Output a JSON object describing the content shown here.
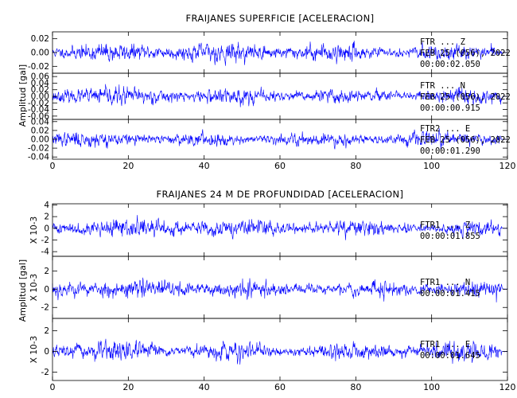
{
  "chart_data": [
    {
      "type": "line",
      "title": "FRAIJANES SUPERFICIE [ACELERACION]",
      "ylabel": "Amplitud [gal]",
      "xlim": [
        0,
        120
      ],
      "xticks": [
        0,
        20,
        40,
        60,
        80,
        100,
        120
      ],
      "color": "#0000ff",
      "panels": [
        {
          "ylim": [
            -0.03,
            0.03
          ],
          "yticks": [
            "0.02",
            "0.00",
            "-0.02"
          ],
          "ytick_values": [
            0.02,
            0.0,
            -0.02
          ],
          "amplitude": 0.009,
          "seed": 11,
          "annotation": [
            "FTR ... Z",
            "FEB 25 (056), 2022",
            "00:00:02.050"
          ]
        },
        {
          "ylim": [
            -0.07,
            0.07
          ],
          "yticks": [
            "0.06",
            "0.04",
            "0.02",
            "0.00",
            "-0.02",
            "-0.04",
            "-0.06"
          ],
          "ytick_values": [
            0.06,
            0.04,
            0.02,
            0.0,
            -0.02,
            -0.04,
            -0.06
          ],
          "amplitude": 0.018,
          "seed": 23,
          "annotation": [
            "FTR ... N",
            "FEB 25 (056), 2022",
            "00:00:00.915"
          ]
        },
        {
          "ylim": [
            -0.045,
            0.045
          ],
          "yticks": [
            "0.04",
            "0.02",
            "0.00",
            "-0.02",
            "-0.04"
          ],
          "ytick_values": [
            0.04,
            0.02,
            0.0,
            -0.02,
            -0.04
          ],
          "amplitude": 0.012,
          "seed": 37,
          "annotation": [
            "FTR2 ... E",
            "FEB 25 (056), 2022",
            "00:00:01.290"
          ]
        }
      ]
    },
    {
      "type": "line",
      "title": "FRAIJANES 24 M DE PROFUNDIDAD [ACELERACION]",
      "ylabel": "Amplitud [gal]",
      "xlim": [
        0,
        120
      ],
      "xticks": [
        0,
        20,
        40,
        60,
        80,
        100,
        120
      ],
      "color": "#0000ff",
      "panels": [
        {
          "ylim": [
            -4.8,
            4.2
          ],
          "yticks": [
            "4",
            "2",
            "0",
            "-2",
            "-4"
          ],
          "ytick_values": [
            4,
            2,
            0,
            -2,
            -4
          ],
          "amplitude": 1.1,
          "seed": 41,
          "scale_label": "X 10-3",
          "annotation": [
            "FTR1 ... Z",
            "00:00:01.855"
          ]
        },
        {
          "ylim": [
            -3.2,
            3.6
          ],
          "yticks": [
            "2",
            "0",
            "-2"
          ],
          "ytick_values": [
            2,
            0,
            -2
          ],
          "amplitude": 0.75,
          "seed": 53,
          "scale_label": "X 10-3",
          "annotation": [
            "FTR1 ... N",
            "00:00:01.415"
          ]
        },
        {
          "ylim": [
            -2.8,
            3.2
          ],
          "yticks": [
            "2",
            "0",
            "-2"
          ],
          "ytick_values": [
            2,
            0,
            -2
          ],
          "amplitude": 0.65,
          "seed": 67,
          "scale_label": "X 10-3",
          "annotation": [
            "FTR1 ... E",
            "00:00:01.645"
          ]
        }
      ]
    }
  ]
}
